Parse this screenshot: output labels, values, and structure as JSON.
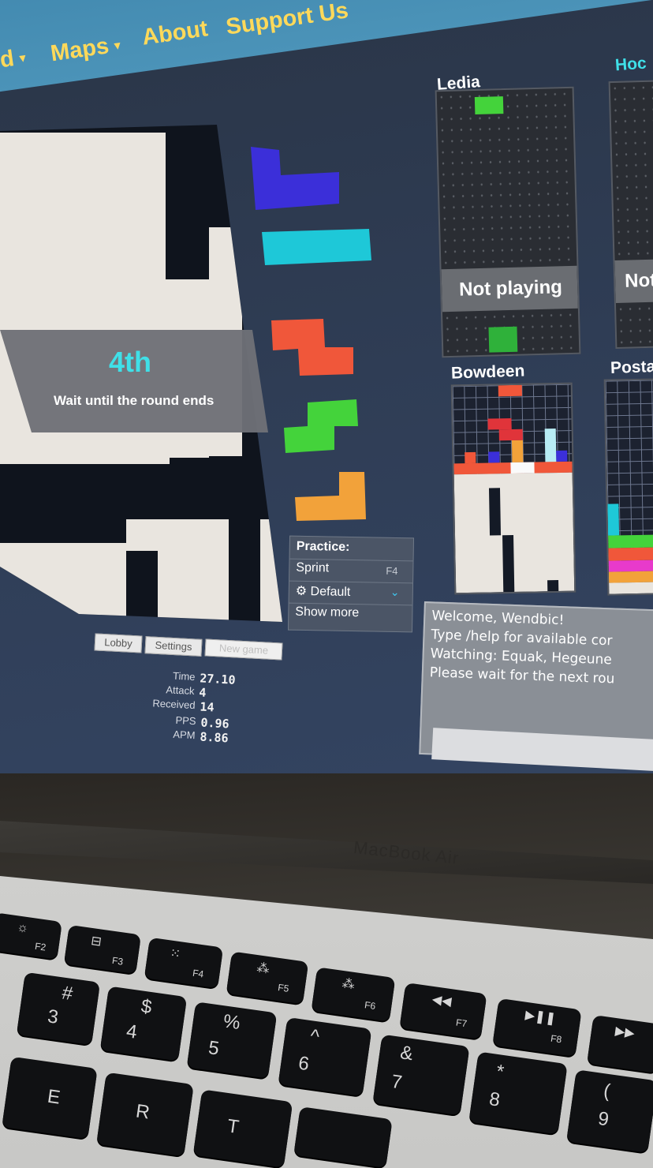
{
  "nav": {
    "partial": "d",
    "maps": "Maps",
    "about": "About",
    "support": "Support Us"
  },
  "game": {
    "place": "4th",
    "message": "Wait until the round ends",
    "buttons": {
      "lobby": "Lobby",
      "settings": "Settings",
      "new_game": "New game"
    },
    "stats": [
      {
        "label": "Time",
        "value": "27.10"
      },
      {
        "label": "Attack",
        "value": "4"
      },
      {
        "label": "Received",
        "value": "14"
      },
      {
        "label": "PPS",
        "value": "0.96"
      },
      {
        "label": "APM",
        "value": "8.86"
      }
    ],
    "next_queue": [
      "J-blue",
      "I-cyan",
      "Z-red",
      "S-green",
      "L-orange"
    ]
  },
  "colors": {
    "J": "#3b2fd9",
    "I": "#1ec8d8",
    "Z": "#f0573a",
    "S": "#44d33b",
    "L": "#f2a23a",
    "nav_text": "#ffd95a",
    "accent": "#3fe0e8"
  },
  "practice": {
    "title": "Practice:",
    "sprint": "Sprint",
    "sprint_key": "F4",
    "default": "Default",
    "show_more": "Show more"
  },
  "opponents": [
    {
      "name": "Ledia",
      "status": "Not playing"
    },
    {
      "name": "Hoc",
      "status": "Not"
    },
    {
      "name": "Bowdeen",
      "status": ""
    },
    {
      "name": "Posta",
      "status": ""
    }
  ],
  "chat": {
    "lines": [
      "Welcome, Wendbic!",
      "Type /help for available cor",
      "Watching: Equak, Hegeune",
      "Please wait for the next rou"
    ]
  },
  "laptop": {
    "brand": "MacBook Air"
  },
  "keys": {
    "fn": [
      "F2",
      "F3",
      "F4",
      "F5",
      "F6",
      "F7",
      "F8"
    ],
    "num_top": [
      "#",
      "$",
      "%",
      "^",
      "&",
      "*",
      "("
    ],
    "num_bottom": [
      "3",
      "4",
      "5",
      "6",
      "7",
      "8",
      "9"
    ],
    "letters": [
      "E",
      "R",
      "T"
    ]
  }
}
